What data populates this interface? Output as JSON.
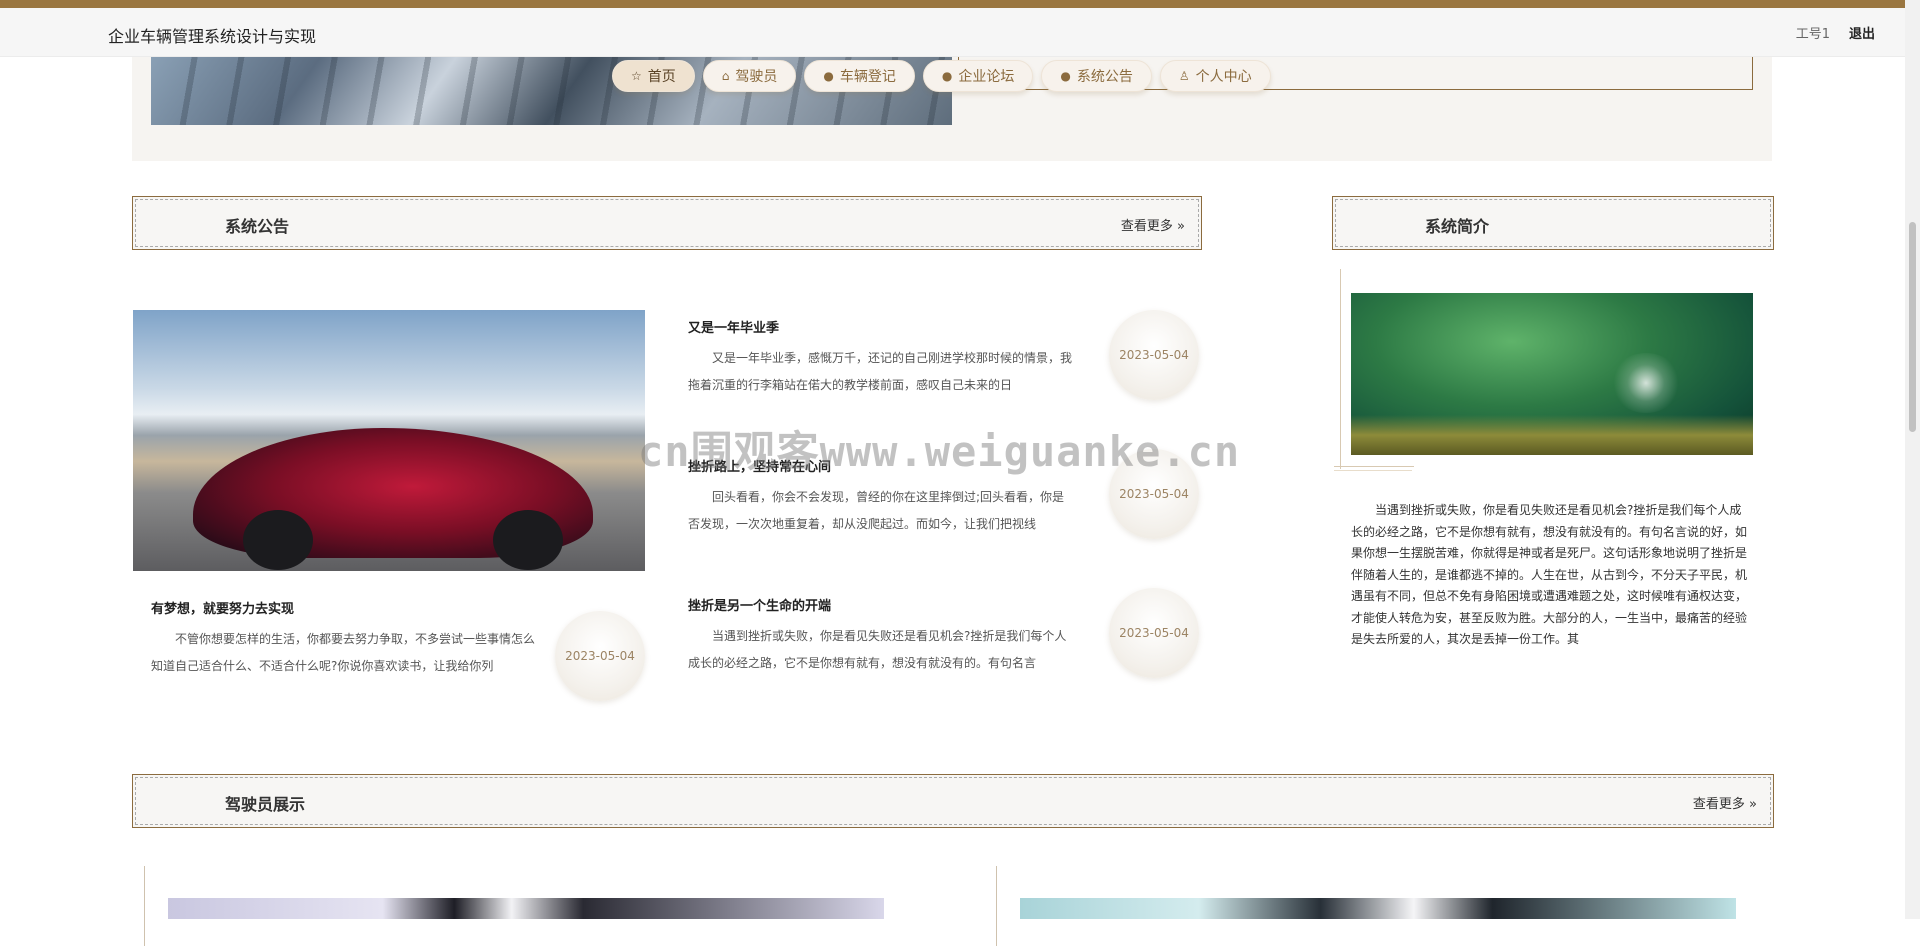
{
  "header": {
    "title": "企业车辆管理系统设计与实现",
    "user": "工号1",
    "logout": "退出"
  },
  "nav": [
    {
      "label": "首页",
      "icon": "star-icon",
      "glyph": "☆"
    },
    {
      "label": "驾驶员",
      "icon": "bag-icon",
      "glyph": "⌂"
    },
    {
      "label": "车辆登记",
      "icon": "info-icon",
      "glyph": "●"
    },
    {
      "label": "企业论坛",
      "icon": "question-icon",
      "glyph": "●"
    },
    {
      "label": "系统公告",
      "icon": "info-icon",
      "glyph": "●"
    },
    {
      "label": "个人中心",
      "icon": "user-icon",
      "glyph": "♙"
    }
  ],
  "notice": {
    "title": "系统公告",
    "more": "查看更多",
    "featured": {
      "title": "有梦想，就要努力去实现",
      "body": "不管你想要怎样的生活，你都要去努力争取，不多尝试一些事情怎么知道自己适合什么、不适合什么呢?你说你喜欢读书，让我给你列",
      "date": "2023-05-04"
    },
    "posts": [
      {
        "title": "又是一年毕业季",
        "body": "又是一年毕业季，感慨万千，还记的自己刚进学校那时候的情景，我拖着沉重的行李箱站在偌大的教学楼前面，感叹自己未来的日",
        "date": "2023-05-04"
      },
      {
        "title": "挫折路上，坚持常在心间",
        "body": "回头看看，你会不会发现，曾经的你在这里摔倒过;回头看看，你是否发现，一次次地重复着，却从没爬起过。而如今，让我们把视线",
        "date": "2023-05-04"
      },
      {
        "title": "挫折是另一个生命的开端",
        "body": "当遇到挫折或失败，你是看见失败还是看见机会?挫折是我们每个人成长的必经之路，它不是你想有就有，想没有就没有的。有句名言",
        "date": "2023-05-04"
      }
    ]
  },
  "intro": {
    "title": "系统简介",
    "body": "当遇到挫折或失败，你是看见失败还是看见机会?挫折是我们每个人成长的必经之路，它不是你想有就有，想没有就没有的。有句名言说的好，如果你想一生摆脱苦难，你就得是神或者是死尸。这句话形象地说明了挫折是伴随着人生的，是谁都逃不掉的。人生在世，从古到今，不分天子平民，机遇虽有不同，但总不免有身陷困境或遭遇难题之处，这时候唯有通权达变，才能使人转危为安，甚至反败为胜。大部分的人，一生当中，最痛苦的经验是失去所爱的人，其次是丢掉一份工作。其"
  },
  "drivers": {
    "title": "驾驶员展示",
    "more": "查看更多"
  },
  "watermark": "cn围观客www.weiguanke.cn",
  "colors": {
    "accent": "#8b6b3e",
    "topbar": "#9a7640"
  }
}
